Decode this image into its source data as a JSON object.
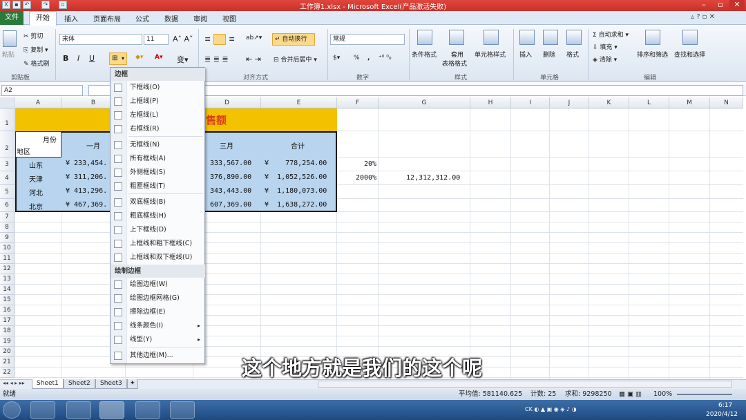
{
  "window": {
    "title": "工作簿1.xlsx - Microsoft Excel(产品激活失败)"
  },
  "menu": {
    "file": "文件",
    "tabs": [
      "开始",
      "插入",
      "页面布局",
      "公式",
      "数据",
      "审阅",
      "视图"
    ]
  },
  "clipboard": {
    "paste": "粘贴",
    "cut": "剪切",
    "copy": "复制",
    "format_painter": "格式刷",
    "group": "剪贴板"
  },
  "font": {
    "name": "宋体",
    "size": "11",
    "bold": "B",
    "italic": "I",
    "underline": "U",
    "change_case": "变"
  },
  "alignment": {
    "wrap": "自动换行",
    "merge": "合并后居中",
    "group": "对齐方式"
  },
  "number": {
    "format": "常规",
    "percent": "%",
    "comma": ",",
    "group": "数字"
  },
  "styles": {
    "conditional": "条件格式",
    "table1": "套用",
    "table2": "表格格式",
    "cell_styles": "单元格样式",
    "group": "样式"
  },
  "cells": {
    "insert": "插入",
    "delete": "删除",
    "format": "格式",
    "group": "单元格"
  },
  "editing": {
    "autosum": "自动求和",
    "fill": "填充",
    "clear": "清除",
    "sort": "排序和筛选",
    "find": "查找和选择",
    "group": "编辑"
  },
  "namebox": "A2",
  "columns": [
    "A",
    "B",
    "C",
    "D",
    "E",
    "F",
    "G",
    "H",
    "I",
    "J",
    "K",
    "L",
    "M",
    "N"
  ],
  "rows": [
    "1",
    "2",
    "3",
    "4",
    "5",
    "6",
    "7",
    "8",
    "9",
    "10",
    "11",
    "12",
    "13",
    "14",
    "15",
    "16",
    "17",
    "18",
    "19",
    "20",
    "21",
    "22"
  ],
  "sheet": {
    "title_fragment": "售额",
    "header_month": "月份",
    "header_region": "地区",
    "months": [
      "一月",
      "三月",
      "合计"
    ],
    "regions": [
      "山东",
      "天津",
      "河北",
      "北京"
    ],
    "jan": [
      "¥  233,454.",
      "¥  311,206.",
      "¥  413,296.",
      "¥  467,369."
    ],
    "mar": [
      "333,567.00",
      "376,890.00",
      "343,443.00",
      "607,369.00"
    ],
    "total": [
      "¥    778,254.00",
      "¥  1,052,526.00",
      "¥  1,180,073.00",
      "¥  1,638,272.00"
    ],
    "f3": "20%",
    "f4": "2000%",
    "g4": "12,312,312.00"
  },
  "border_menu": {
    "header1": "边框",
    "items1": [
      "下框线(O)",
      "上框线(P)",
      "左框线(L)",
      "右框线(R)"
    ],
    "items2": [
      "无框线(N)",
      "所有框线(A)",
      "外侧框线(S)",
      "粗匣框线(T)"
    ],
    "items3": [
      "双底框线(B)",
      "粗底框线(H)",
      "上下框线(D)",
      "上框线和粗下框线(C)",
      "上框线和双下框线(U)"
    ],
    "header2": "绘制边框",
    "items4": [
      "绘图边框(W)",
      "绘图边框网格(G)",
      "擦除边框(E)",
      "线条颜色(I)",
      "线型(Y)"
    ],
    "more": "其他边框(M)..."
  },
  "sheet_tabs": [
    "Sheet1",
    "Sheet2",
    "Sheet3"
  ],
  "status": {
    "ready": "就绪",
    "average": "平均值: 581140.625",
    "count": "计数: 25",
    "sum": "求和: 9298250",
    "zoom": "100%"
  },
  "clock": {
    "time": "6:17",
    "date": "2020/4/12"
  },
  "subtitle": "这个地方就是我们的这个呢",
  "colors": {
    "title_bar": "#d9534f",
    "header_fill": "#f2c200",
    "data_fill": "#b8d4ee",
    "title_text": "#e03a1e"
  }
}
